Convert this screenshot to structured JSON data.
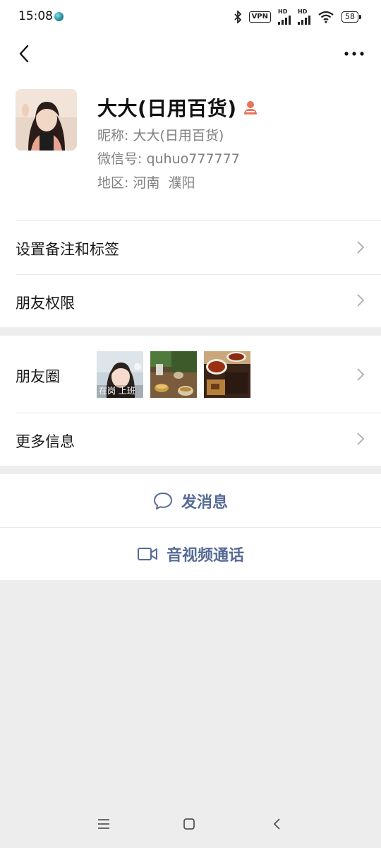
{
  "status_bar": {
    "time": "15:08",
    "vpn": "VPN",
    "hd1": "HD",
    "hd2": "HD",
    "battery": "58"
  },
  "profile": {
    "name": "大大(日用百货)",
    "nickname_label": "昵称:",
    "nickname": "大大(日用百货)",
    "wechat_label": "微信号:",
    "wechat_id": "quhuo777777",
    "region_label": "地区:",
    "region": "河南  濮阳"
  },
  "menu": {
    "remark_tags": "设置备注和标签",
    "friend_permission": "朋友权限",
    "moments": "朋友圈",
    "more_info": "更多信息"
  },
  "moments_thumbs": [
    {
      "caption": "在岗 上班"
    },
    {
      "caption": ""
    },
    {
      "caption": ""
    }
  ],
  "actions": {
    "send_message": "发消息",
    "video_call": "音视频通话"
  },
  "colors": {
    "link_blue": "#576b95",
    "background": "#ededed",
    "badge": "#e8735a"
  },
  "icons": [
    "back-icon",
    "more-icon",
    "chevron-right-icon",
    "chat-bubble-icon",
    "video-camera-icon",
    "menu-icon",
    "home-icon",
    "nav-back-icon",
    "bluetooth-icon",
    "wifi-icon"
  ]
}
